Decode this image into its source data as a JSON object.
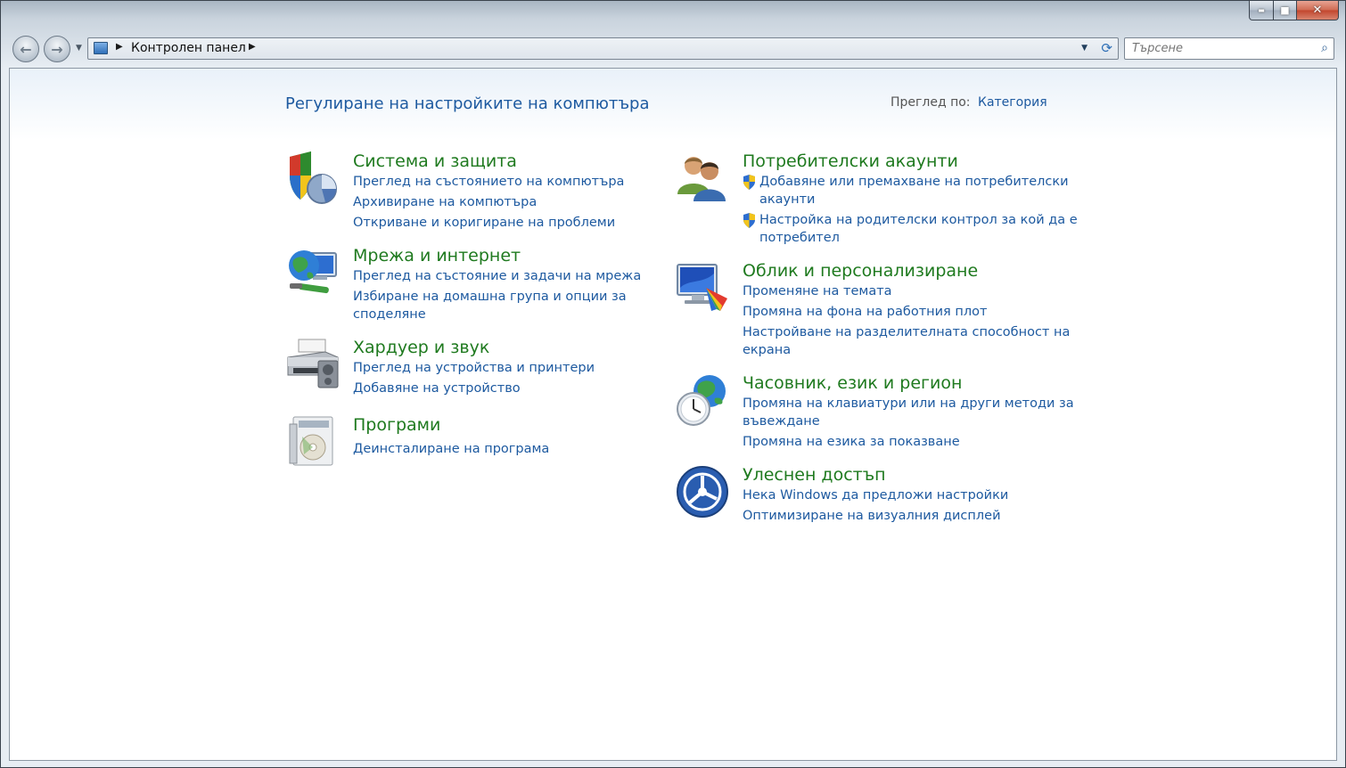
{
  "window": {
    "caption": {
      "minimize": "▬",
      "maximize": "■",
      "close": "✕"
    }
  },
  "nav": {
    "address_path": "Контролен панел",
    "search_placeholder": "Търсене"
  },
  "header": {
    "title": "Регулиране на настройките на компютъра",
    "view_label": "Преглед по:",
    "view_value": "Категория"
  },
  "categories": [
    {
      "title": "Система и защита",
      "icon": "system-security-icon",
      "links": [
        "Преглед на състоянието на компютъра",
        "Архивиране на компютъра",
        "Откриване и коригиране на проблеми"
      ]
    },
    {
      "title": "Мрежа и интернет",
      "icon": "network-internet-icon",
      "links": [
        "Преглед на състояние и задачи на мрежа",
        "Избиране на домашна група и опции за",
        "споделяне"
      ]
    },
    {
      "title": "Хардуер и звук",
      "icon": "hardware-sound-icon",
      "links": [
        "Преглед на устройства и принтери",
        "Добавяне на устройство"
      ]
    },
    {
      "title": "Програми",
      "icon": "programs-icon",
      "links": [
        "Деинсталиране на програма"
      ]
    },
    {
      "title": "Потребителски акаунти",
      "icon": "user-accounts-icon",
      "links": [
        "Добавяне или премахване на потребителски",
        "акаунти",
        "Настройка на родителски контрол за кой да е",
        "потребител"
      ]
    },
    {
      "title": "Облик и персонализиране",
      "icon": "appearance-icon",
      "links": [
        "Променяне на темата",
        "Промяна на фона на работния плот",
        "Настройване на разделителната способност на",
        "екрана"
      ]
    },
    {
      "title": "Часовник, език и регион",
      "icon": "clock-language-icon",
      "links": [
        "Промяна на клавиатури или на други методи за",
        "въвеждане",
        "Промяна на езика за показване"
      ]
    },
    {
      "title": "Улеснен достъп",
      "icon": "ease-of-access-icon",
      "links": [
        "Нека Windows да предложи настройки",
        "Оптимизиране на визуалния дисплей"
      ]
    }
  ]
}
